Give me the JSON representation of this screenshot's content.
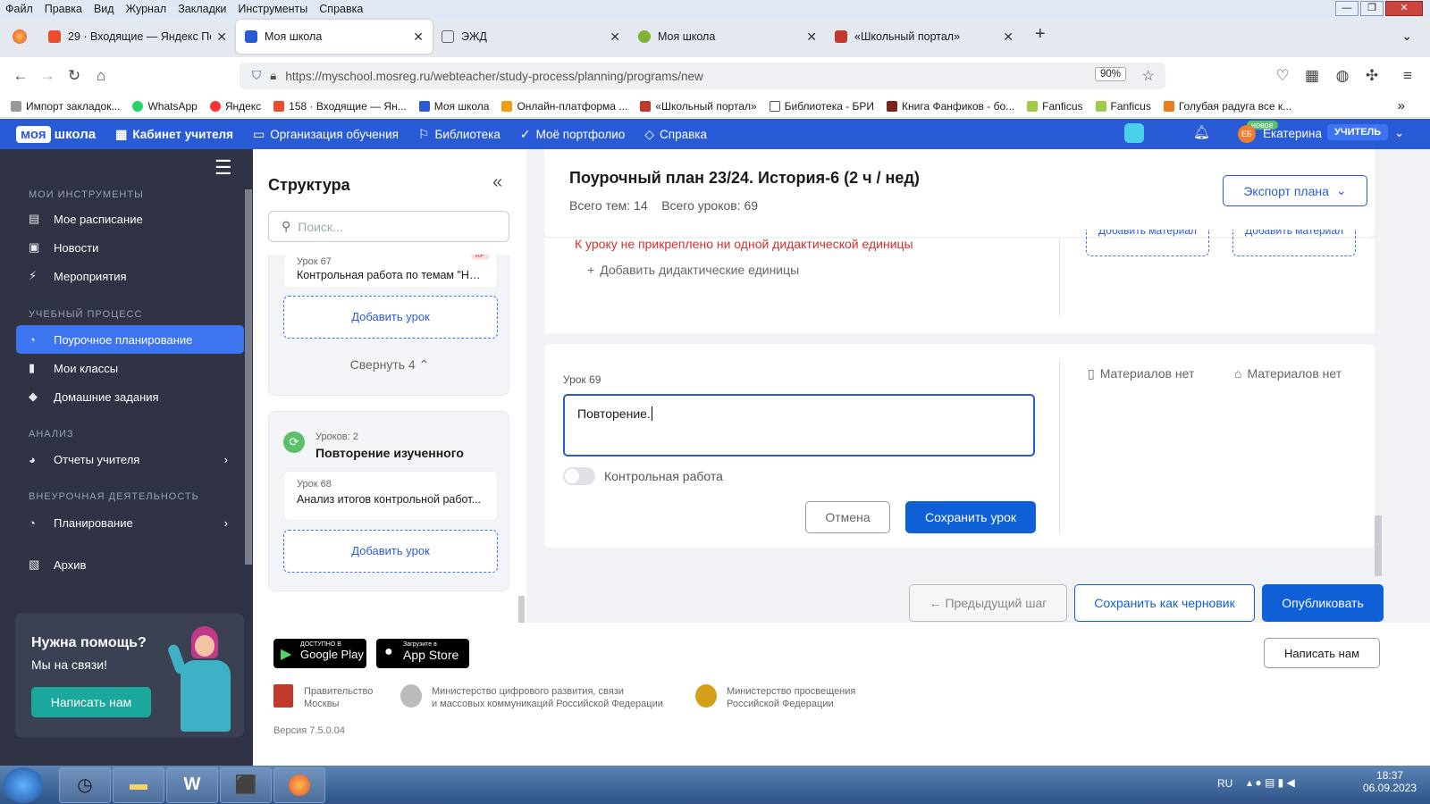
{
  "menubar": [
    "Файл",
    "Правка",
    "Вид",
    "Журнал",
    "Закладки",
    "Инструменты",
    "Справка"
  ],
  "tabs": [
    {
      "label": "29 · Входящие — Яндекс Почта",
      "color": "#e94f2e"
    },
    {
      "label": "Моя школа",
      "color": "#2a5bd7"
    },
    {
      "label": "ЭЖД",
      "color": "#666"
    },
    {
      "label": "Моя школа",
      "color": "#7db334"
    },
    {
      "label": "«Школьный портал»",
      "color": "#c0392b"
    }
  ],
  "url": "https://myschool.mosreg.ru/webteacher/study-process/planning/programs/new",
  "zoom": "90%",
  "bookmarks": [
    "Импорт закладок...",
    "WhatsApp",
    "Яндекс",
    "158 · Входящие — Ян...",
    "Моя школа",
    "Онлайн-платформа ...",
    "«Школьный портал»",
    "Библиотека - БРИ",
    "Книга Фанфиков - бо...",
    "Fanficus",
    "Fanficus",
    "Голубая радуга все к..."
  ],
  "header": {
    "logo_a": "моя",
    "logo_b": "школа",
    "nav": [
      "Кабинет учителя",
      "Организация обучения",
      "Библиотека",
      "Моё портфолио",
      "Справка"
    ],
    "new_badge": "новое",
    "initials": "ЕБ",
    "user": "Екатерина",
    "role": "УЧИТЕЛЬ"
  },
  "sidebar": {
    "sec1": "МОИ ИНСТРУМЕНТЫ",
    "i1": "Мое расписание",
    "i2": "Новости",
    "i3": "Мероприятия",
    "sec2": "УЧЕБНЫЙ ПРОЦЕСС",
    "i4": "Поурочное планирование",
    "i5": "Мои классы",
    "i6": "Домашние задания",
    "sec3": "АНАЛИЗ",
    "i7": "Отчеты учителя",
    "sec4": "ВНЕУРОЧНАЯ ДЕЯТЕЛЬНОСТЬ",
    "i8": "Планирование",
    "i9": "Архив",
    "help_title": "Нужна помощь?",
    "help_sub": "Мы на связи!",
    "help_btn": "Написать нам"
  },
  "structure": {
    "title": "Структура",
    "search_placeholder": "Поиск...",
    "l67_num": "Урок 67",
    "l67_title": "Контрольная работа по темам \"Нар...",
    "l67_tag": "КР",
    "add": "Добавить урок",
    "collapse": "Свернуть 4",
    "sec_count": "Уроков: 2",
    "sec_title": "Повторение изученного",
    "l68_num": "Урок 68",
    "l68_title": "Анализ итогов контрольной работ..."
  },
  "plan": {
    "title": "Поурочный план 23/24. История-6 (2 ч / нед)",
    "themes": "Всего тем: 14",
    "lessons": "Всего уроков: 69",
    "export": "Экспорт плана"
  },
  "block1": {
    "warning": "К уроку не прикреплено ни одной дидактической единицы",
    "add_units": "Добавить дидактические единицы",
    "add_mat": "Добавить материал"
  },
  "lesson": {
    "num": "Урок 69",
    "value": "Повторение.",
    "toggle": "Контрольная работа",
    "cancel": "Отмена",
    "save": "Сохранить урок",
    "mat1": "Материалов нет",
    "mat2": "Материалов нет"
  },
  "actions": {
    "prev": "← Предыдущий шаг",
    "draft": "Сохранить как черновик",
    "publish": "Опубликовать"
  },
  "footer": {
    "gp_small": "ДОСТУПНО В",
    "gp": "Google Play",
    "as_small": "Загрузите в",
    "as": "App Store",
    "write": "Написать нам",
    "gov1a": "Правительство",
    "gov1b": "Москвы",
    "gov2a": "Министерство цифрового развития, связи",
    "gov2b": "и массовых коммуникаций Российской Федерации",
    "gov3a": "Министерство просвещения",
    "gov3b": "Российской Федерации",
    "version": "Версия 7.5.0.04"
  },
  "taskbar": {
    "lang": "RU",
    "time": "18:37",
    "date": "06.09.2023"
  }
}
